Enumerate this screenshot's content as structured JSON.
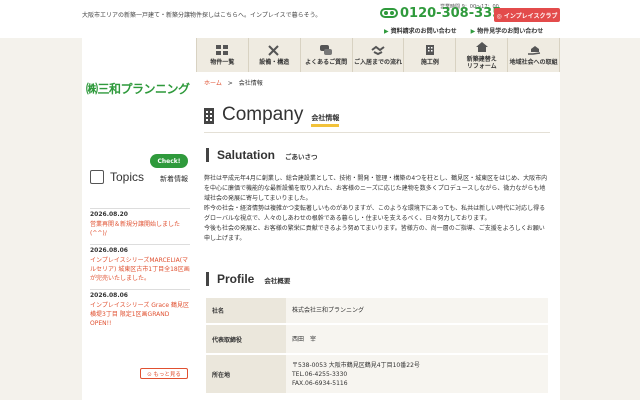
{
  "header": {
    "tagline": "大阪市エリアの新築一戸建て・新築分譲物件探しはこちらへ。インプレイスで暮らそう。",
    "hours": "営業時間 9：00～17：00",
    "phone": "0120-308-335",
    "club_button": "◎ インプレイスクラブ",
    "links": [
      "資料請求のお問い合わせ",
      "物件見学のお問い合わせ"
    ]
  },
  "logo": "㈱三和プランニング",
  "nav": [
    {
      "label": "物件一覧",
      "icon": "house-list-icon"
    },
    {
      "label": "設備・構造",
      "icon": "tools-icon"
    },
    {
      "label": "よくあるご質問",
      "icon": "chat-icon"
    },
    {
      "label": "ご入居までの流れ",
      "icon": "handshake-icon"
    },
    {
      "label": "施工例",
      "icon": "building-icon"
    },
    {
      "label": "新築建替え\nリフォーム",
      "icon": "house-icon"
    },
    {
      "label": "地域社会への取組",
      "icon": "hand-house-icon"
    }
  ],
  "breadcrumb": {
    "home": "ホーム",
    "sep": ">",
    "current": "会社情報"
  },
  "page": {
    "title_en": "Company",
    "title_jp": "会社情報"
  },
  "salutation": {
    "title_en": "Salutation",
    "title_jp": "ごあいさつ",
    "body": "弊社は平成元年4月に創業し、総合建設業として、技術・開発・管理・構築の4つを柱とし、鶴見区・城東区をはじめ、大阪市内を中心に廉価で機能的な最新設備を取り入れた、お客様のニーズに応じた建物を数多くプロデュースしながら、微力ながらも地域社会の発展に寄与してまいりました。\n昨今の社会・経済情勢は複雑かつ変転著しいものがありますが、このような環境下にあっても、私共は新しい時代に対応し得るグローバルな視点で、人々のしあわせの根幹である暮らし・住まいを支えるべく、日々努力しております。\n今後も社会の発展と、お客様の繁栄に貢献できるよう努めてまいります。皆様方の、尚一層のご指導、ご支援をよろしくお願い申し上げます。"
  },
  "profile": {
    "title_en": "Profile",
    "title_jp": "会社概要",
    "rows": [
      {
        "key": "社名",
        "value": [
          "株式会社三和プランニング"
        ]
      },
      {
        "key": "代表取締役",
        "value": [
          "西田　宰"
        ]
      },
      {
        "key": "所在地",
        "value": [
          "〒538-0053 大阪市鶴見区鶴見4丁目10番22号",
          "TEL.06-4255-3330",
          "FAX.06-6934-5116"
        ]
      }
    ]
  },
  "topics": {
    "badge": "Check!",
    "title": "Topics",
    "subtitle": "新着情報",
    "items": [
      {
        "date": "2026.08.20",
        "text": "営業再開＆新規分譲開始しました(^^)/"
      },
      {
        "date": "2026.08.06",
        "text": "インプレイスシリーズMARCELIA(マルセリア) 城東区古市1丁目全18区画が完売いたしました。"
      },
      {
        "date": "2026.08.06",
        "text": "インプレイスシリーズ Grace 鶴見区横堤3丁目 限定1区画GRAND OPEN!!"
      }
    ],
    "more": "⊙ もっと見る"
  },
  "colors": {
    "accent_green": "#2f9a3c",
    "accent_red": "#e05030",
    "highlight_yellow": "#f2c23a"
  }
}
